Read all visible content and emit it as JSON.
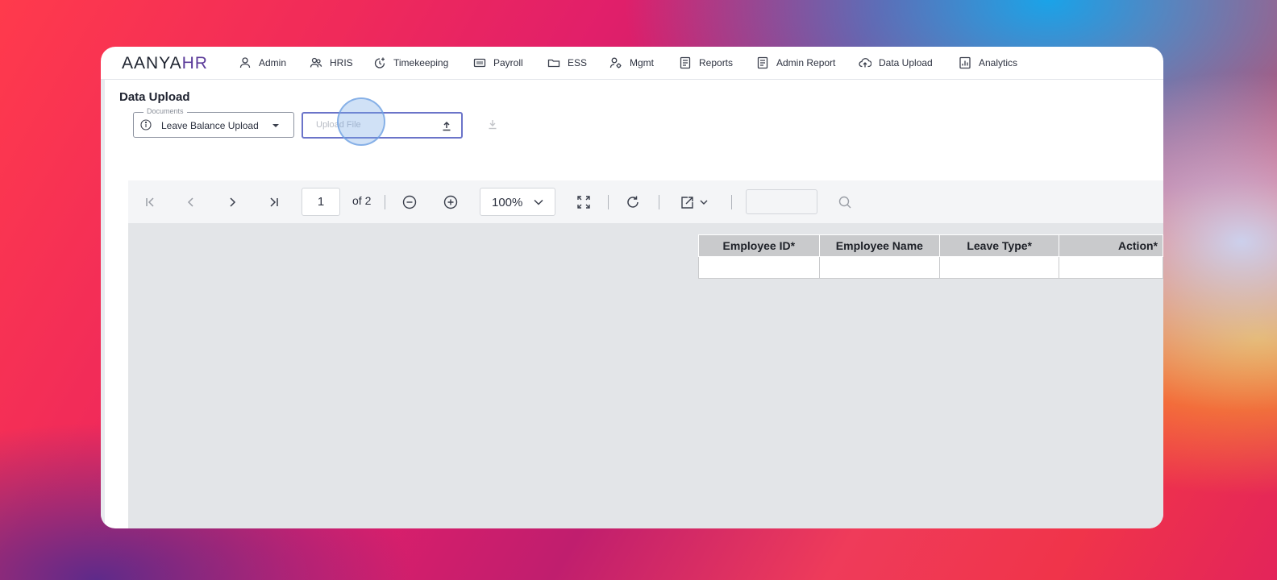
{
  "app": {
    "logo_main": "AANYA",
    "logo_accent": "HR"
  },
  "nav": {
    "items": [
      {
        "label": "Admin",
        "icon": "user-icon"
      },
      {
        "label": "HRIS",
        "icon": "users-icon"
      },
      {
        "label": "Timekeeping",
        "icon": "clock-plus-icon"
      },
      {
        "label": "Payroll",
        "icon": "payroll-card-icon"
      },
      {
        "label": "ESS",
        "icon": "folder-icon"
      },
      {
        "label": "Mgmt",
        "icon": "user-gear-icon"
      },
      {
        "label": "Reports",
        "icon": "document-icon"
      },
      {
        "label": "Admin Report",
        "icon": "document-icon"
      },
      {
        "label": "Data Upload",
        "icon": "cloud-upload-icon"
      },
      {
        "label": "Analytics",
        "icon": "chart-icon"
      }
    ]
  },
  "page": {
    "title": "Data Upload"
  },
  "documents_select": {
    "legend": "Documents",
    "value": "Leave Balance Upload"
  },
  "upload": {
    "placeholder": "Upload File"
  },
  "viewer": {
    "page_current": "1",
    "page_total_label": "of 2",
    "zoom": "100%"
  },
  "table": {
    "headers": [
      "Employee ID*",
      "Employee Name",
      "Leave Type*",
      "Action*"
    ]
  },
  "colors": {
    "accent": "#6b74c9",
    "logo_accent": "#5c3c9a",
    "header_bg": "#c9cacc"
  }
}
